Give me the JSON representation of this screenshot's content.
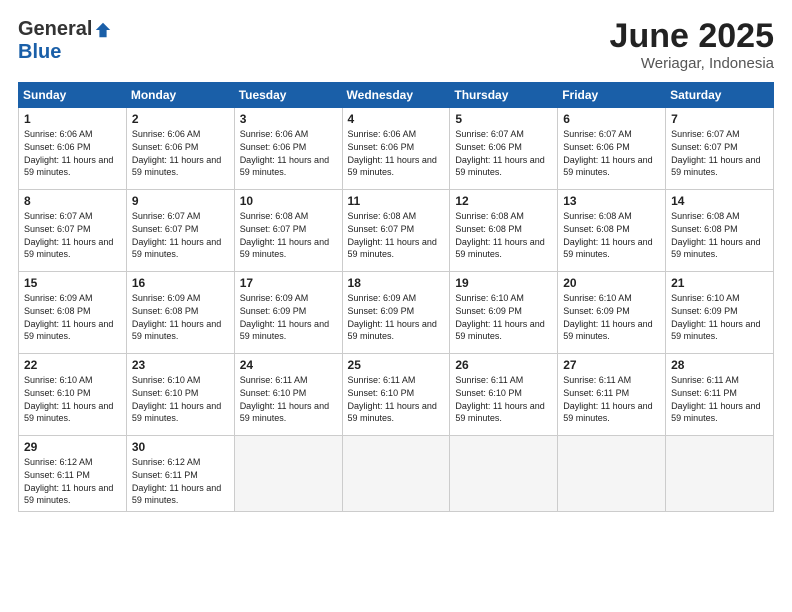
{
  "header": {
    "logo_general": "General",
    "logo_blue": "Blue",
    "month_title": "June 2025",
    "location": "Weriagar, Indonesia"
  },
  "weekdays": [
    "Sunday",
    "Monday",
    "Tuesday",
    "Wednesday",
    "Thursday",
    "Friday",
    "Saturday"
  ],
  "weeks": [
    [
      {
        "day": "1",
        "sunrise": "6:06 AM",
        "sunset": "6:06 PM",
        "daylight": "11 hours and 59 minutes."
      },
      {
        "day": "2",
        "sunrise": "6:06 AM",
        "sunset": "6:06 PM",
        "daylight": "11 hours and 59 minutes."
      },
      {
        "day": "3",
        "sunrise": "6:06 AM",
        "sunset": "6:06 PM",
        "daylight": "11 hours and 59 minutes."
      },
      {
        "day": "4",
        "sunrise": "6:06 AM",
        "sunset": "6:06 PM",
        "daylight": "11 hours and 59 minutes."
      },
      {
        "day": "5",
        "sunrise": "6:07 AM",
        "sunset": "6:06 PM",
        "daylight": "11 hours and 59 minutes."
      },
      {
        "day": "6",
        "sunrise": "6:07 AM",
        "sunset": "6:06 PM",
        "daylight": "11 hours and 59 minutes."
      },
      {
        "day": "7",
        "sunrise": "6:07 AM",
        "sunset": "6:07 PM",
        "daylight": "11 hours and 59 minutes."
      }
    ],
    [
      {
        "day": "8",
        "sunrise": "6:07 AM",
        "sunset": "6:07 PM",
        "daylight": "11 hours and 59 minutes."
      },
      {
        "day": "9",
        "sunrise": "6:07 AM",
        "sunset": "6:07 PM",
        "daylight": "11 hours and 59 minutes."
      },
      {
        "day": "10",
        "sunrise": "6:08 AM",
        "sunset": "6:07 PM",
        "daylight": "11 hours and 59 minutes."
      },
      {
        "day": "11",
        "sunrise": "6:08 AM",
        "sunset": "6:07 PM",
        "daylight": "11 hours and 59 minutes."
      },
      {
        "day": "12",
        "sunrise": "6:08 AM",
        "sunset": "6:08 PM",
        "daylight": "11 hours and 59 minutes."
      },
      {
        "day": "13",
        "sunrise": "6:08 AM",
        "sunset": "6:08 PM",
        "daylight": "11 hours and 59 minutes."
      },
      {
        "day": "14",
        "sunrise": "6:08 AM",
        "sunset": "6:08 PM",
        "daylight": "11 hours and 59 minutes."
      }
    ],
    [
      {
        "day": "15",
        "sunrise": "6:09 AM",
        "sunset": "6:08 PM",
        "daylight": "11 hours and 59 minutes."
      },
      {
        "day": "16",
        "sunrise": "6:09 AM",
        "sunset": "6:08 PM",
        "daylight": "11 hours and 59 minutes."
      },
      {
        "day": "17",
        "sunrise": "6:09 AM",
        "sunset": "6:09 PM",
        "daylight": "11 hours and 59 minutes."
      },
      {
        "day": "18",
        "sunrise": "6:09 AM",
        "sunset": "6:09 PM",
        "daylight": "11 hours and 59 minutes."
      },
      {
        "day": "19",
        "sunrise": "6:10 AM",
        "sunset": "6:09 PM",
        "daylight": "11 hours and 59 minutes."
      },
      {
        "day": "20",
        "sunrise": "6:10 AM",
        "sunset": "6:09 PM",
        "daylight": "11 hours and 59 minutes."
      },
      {
        "day": "21",
        "sunrise": "6:10 AM",
        "sunset": "6:09 PM",
        "daylight": "11 hours and 59 minutes."
      }
    ],
    [
      {
        "day": "22",
        "sunrise": "6:10 AM",
        "sunset": "6:10 PM",
        "daylight": "11 hours and 59 minutes."
      },
      {
        "day": "23",
        "sunrise": "6:10 AM",
        "sunset": "6:10 PM",
        "daylight": "11 hours and 59 minutes."
      },
      {
        "day": "24",
        "sunrise": "6:11 AM",
        "sunset": "6:10 PM",
        "daylight": "11 hours and 59 minutes."
      },
      {
        "day": "25",
        "sunrise": "6:11 AM",
        "sunset": "6:10 PM",
        "daylight": "11 hours and 59 minutes."
      },
      {
        "day": "26",
        "sunrise": "6:11 AM",
        "sunset": "6:10 PM",
        "daylight": "11 hours and 59 minutes."
      },
      {
        "day": "27",
        "sunrise": "6:11 AM",
        "sunset": "6:11 PM",
        "daylight": "11 hours and 59 minutes."
      },
      {
        "day": "28",
        "sunrise": "6:11 AM",
        "sunset": "6:11 PM",
        "daylight": "11 hours and 59 minutes."
      }
    ],
    [
      {
        "day": "29",
        "sunrise": "6:12 AM",
        "sunset": "6:11 PM",
        "daylight": "11 hours and 59 minutes."
      },
      {
        "day": "30",
        "sunrise": "6:12 AM",
        "sunset": "6:11 PM",
        "daylight": "11 hours and 59 minutes."
      },
      null,
      null,
      null,
      null,
      null
    ]
  ]
}
